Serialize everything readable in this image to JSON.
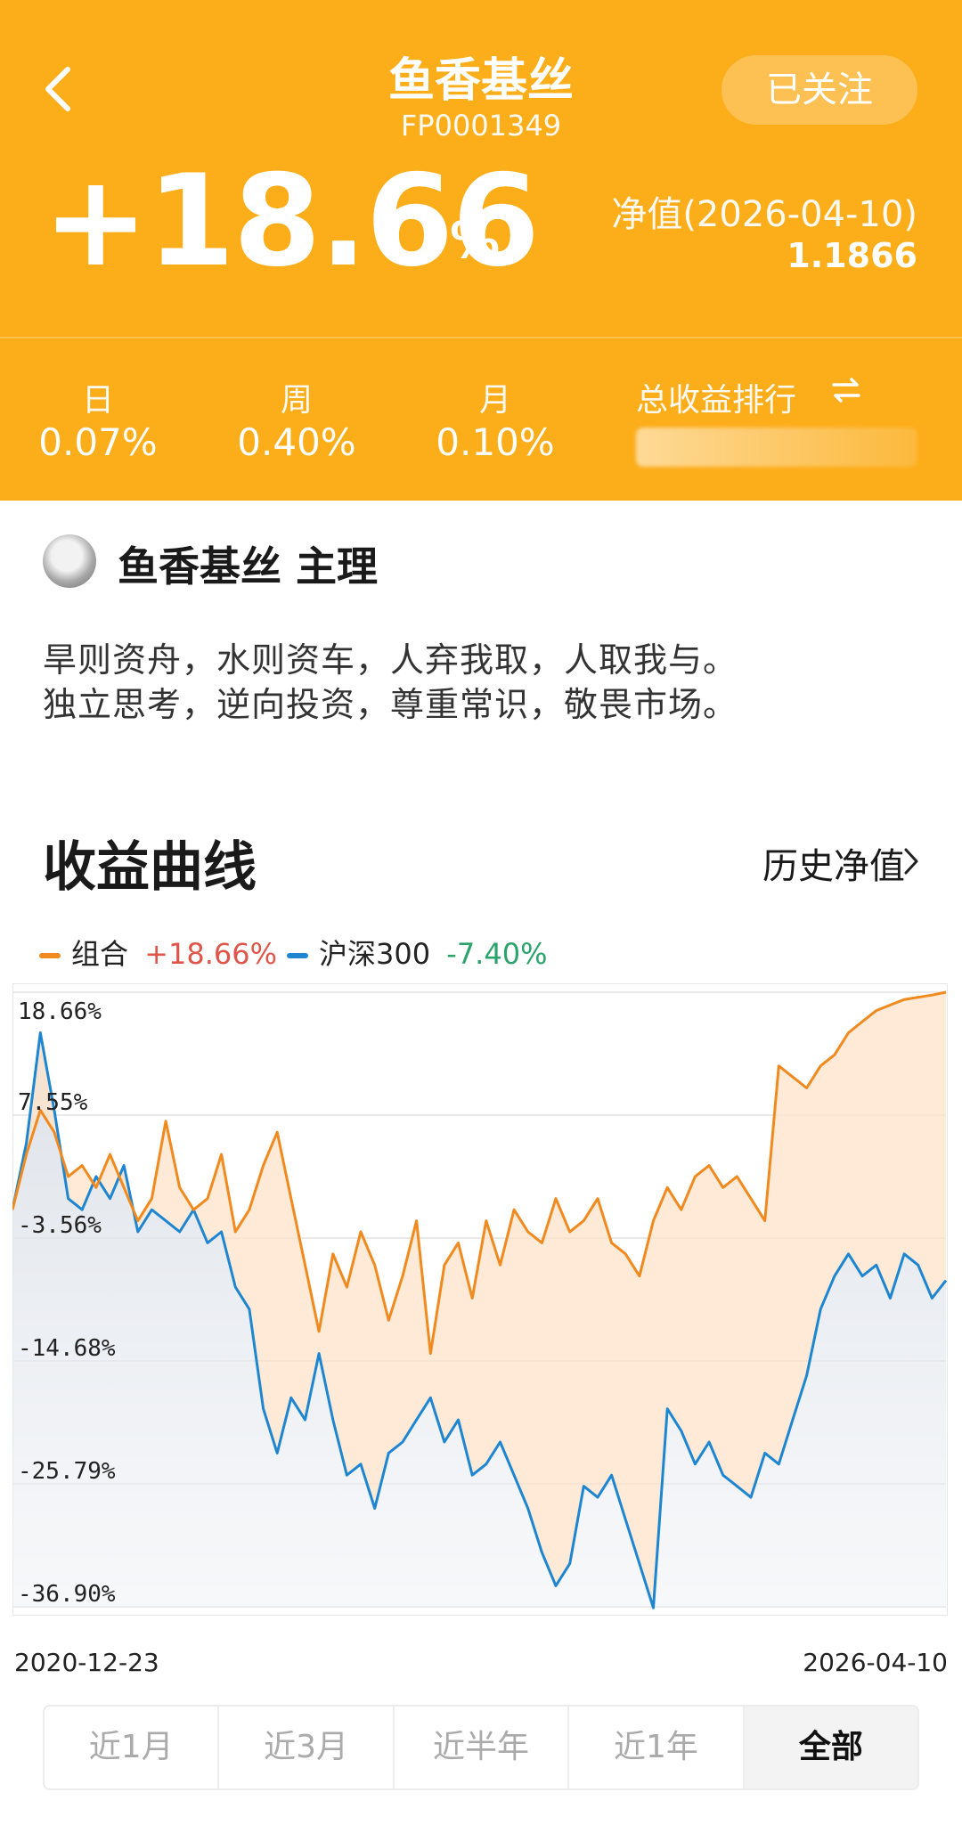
{
  "header": {
    "title": "鱼香基丝",
    "code": "FP0001349",
    "follow_label": "已关注",
    "total_return": "+18.66",
    "total_return_unit": "%",
    "nav_label": "净值(2026-04-10)",
    "nav_value": "1.1866"
  },
  "stats": [
    {
      "label": "日",
      "value": "0.07%"
    },
    {
      "label": "周",
      "value": "0.40%"
    },
    {
      "label": "月",
      "value": "0.10%"
    }
  ],
  "rank": {
    "label": "总收益排行"
  },
  "author": {
    "name": "鱼香基丝 主理"
  },
  "motto": [
    "旱则资舟，水则资车，人弃我取，人取我与。",
    "独立思考，逆向投资，尊重常识，敬畏市场。"
  ],
  "section": {
    "title": "收益曲线",
    "history_label": "历史净值"
  },
  "legend": [
    {
      "name": "组合",
      "value": "+18.66%",
      "color": "#F08A1F",
      "value_color": "#E0554A"
    },
    {
      "name": "沪深300",
      "value": "-7.40%",
      "color": "#1E86D0",
      "value_color": "#2BA36B"
    }
  ],
  "chart_data": {
    "type": "area",
    "x_start": "2020-12-23",
    "x_end": "2026-04-10",
    "ylim": [
      -36.9,
      18.66
    ],
    "y_ticks": [
      "18.66%",
      "7.55%",
      "-3.56%",
      "-14.68%",
      "-25.79%",
      "-36.90%"
    ],
    "y_tick_values": [
      18.66,
      7.55,
      -3.56,
      -14.68,
      -25.79,
      -36.9
    ],
    "grid": true,
    "series": [
      {
        "name": "组合",
        "color": "#F08A1F",
        "values": [
          -1,
          4,
          8,
          6,
          2,
          3,
          1,
          4,
          1,
          -2,
          0,
          7,
          1,
          -1,
          0,
          4,
          -3,
          -1,
          3,
          6,
          0,
          -6,
          -12,
          -5,
          -8,
          -3,
          -6,
          -11,
          -7,
          -2,
          -14,
          -6,
          -4,
          -9,
          -2,
          -6,
          -1,
          -3,
          -4,
          0,
          -3,
          -2,
          0,
          -4,
          -5,
          -7,
          -2,
          1,
          -1,
          2,
          3,
          1,
          2,
          0,
          -2,
          12,
          11,
          10,
          12,
          13,
          15,
          16,
          17,
          17.5,
          18,
          18.2,
          18.4,
          18.66
        ]
      },
      {
        "name": "沪深300",
        "color": "#1E86D0",
        "values": [
          -1,
          5,
          15,
          8,
          0,
          -1,
          2,
          0,
          3,
          -3,
          -1,
          -2,
          -3,
          -1,
          -4,
          -3,
          -8,
          -10,
          -19,
          -23,
          -18,
          -20,
          -14,
          -20,
          -25,
          -24,
          -28,
          -23,
          -22,
          -20,
          -18,
          -22,
          -20,
          -25,
          -24,
          -22,
          -25,
          -28,
          -32,
          -35,
          -33,
          -26,
          -27,
          -25,
          -29,
          -33,
          -37,
          -19,
          -21,
          -24,
          -22,
          -25,
          -26,
          -27,
          -23,
          -24,
          -20,
          -16,
          -10,
          -7,
          -5,
          -7,
          -6,
          -9,
          -5,
          -6,
          -9,
          -7.4
        ]
      }
    ]
  },
  "dates": {
    "start": "2020-12-23",
    "end": "2026-04-10"
  },
  "tabs": [
    {
      "label": "近1月",
      "active": false
    },
    {
      "label": "近3月",
      "active": false
    },
    {
      "label": "近半年",
      "active": false
    },
    {
      "label": "近1年",
      "active": false
    },
    {
      "label": "全部",
      "active": true
    }
  ]
}
